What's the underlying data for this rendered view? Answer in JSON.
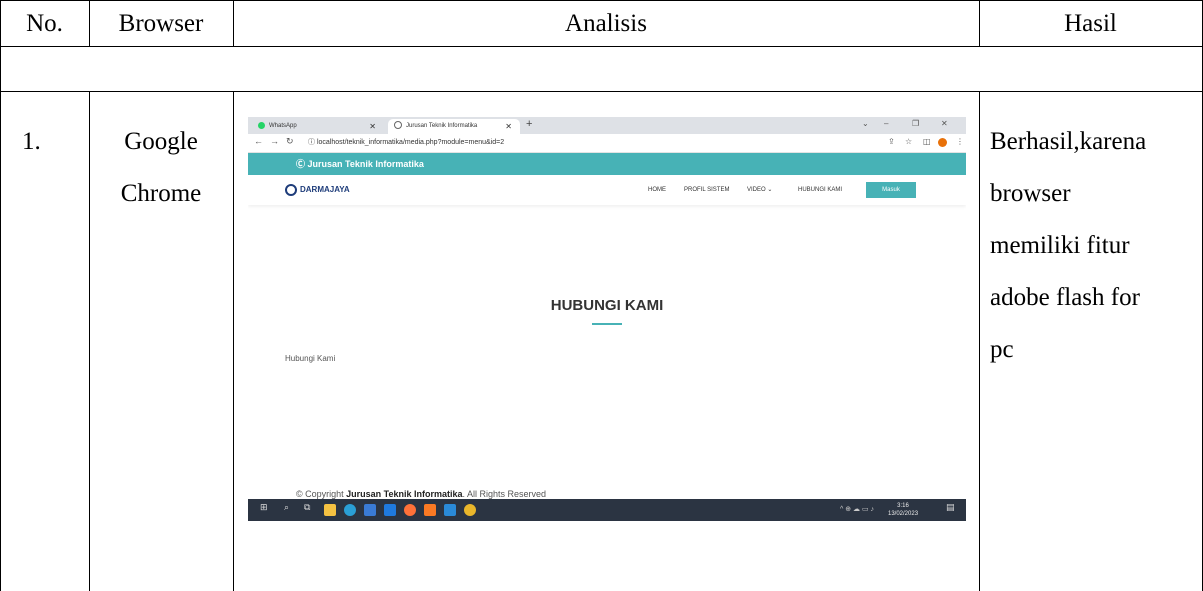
{
  "table": {
    "headers": {
      "no": "No.",
      "browser": "Browser",
      "analisis": "Analisis",
      "hasil": "Hasil"
    },
    "rows": [
      {
        "no": "1.",
        "browser_line1": "Google",
        "browser_line2": "Chrome",
        "hasil_lines": [
          "Berhasil,karena",
          "browser",
          "memiliki fitur",
          "adobe flash for",
          "pc"
        ]
      }
    ]
  },
  "screenshot": {
    "tabs": [
      {
        "label": "WhatsApp",
        "icon": "whatsapp-icon",
        "color": "#25d366"
      },
      {
        "label": "Jurusan Teknik Informatika",
        "icon": "site-icon",
        "color": "#666666"
      }
    ],
    "new_tab": "+",
    "url": "localhost/teknik_informatika/media.php?module=menu&id=2",
    "top_bar_text": "Ⓒ Jurusan Teknik Informatika",
    "logo_text": "DARMAJAYA",
    "menu": [
      "HOME",
      "PROFIL SISTEM",
      "VIDEO ⌄",
      "HUBUNGI KAMI"
    ],
    "masuk": "Masuk",
    "page_title": "HUBUNGI KAMI",
    "body_text": "Hubungi Kami",
    "copyright_prefix": "© Copyright ",
    "copyright_bold": "Jurusan Teknik Informatika",
    "copyright_suffix": ". All Rights Reserved",
    "clock_time": "3:16",
    "clock_date": "13/02/2023",
    "accent_color": "#47b2b6"
  }
}
